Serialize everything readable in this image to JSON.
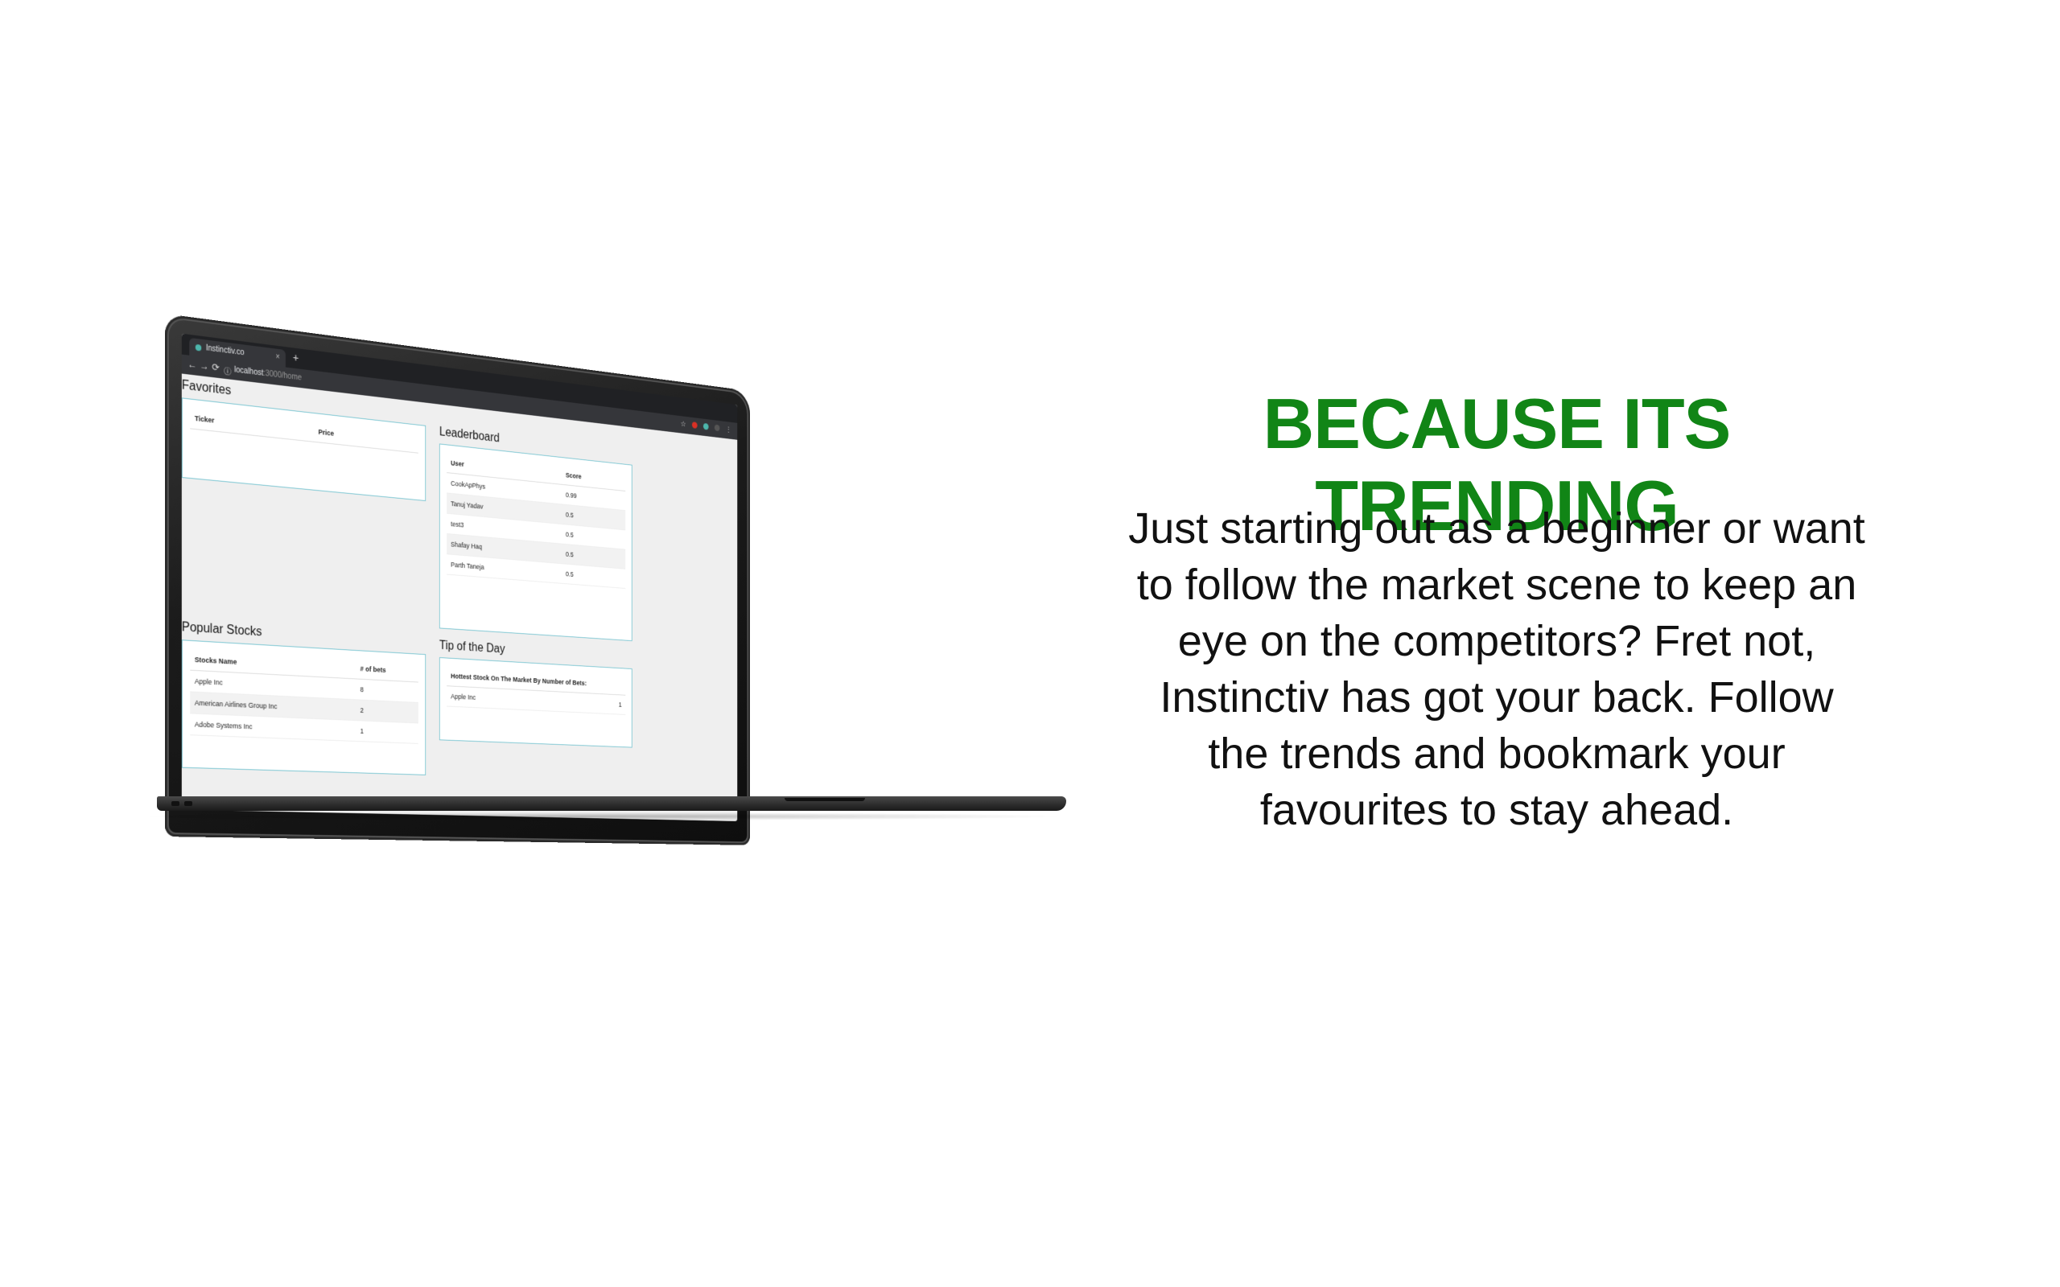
{
  "headline": "BECAUSE ITS TRENDING",
  "body_text": "Just starting out as a beginner or want to follow the market scene to keep an eye on the competitors? Fret not, Instinctiv has got your back. Follow the trends and bookmark your favourites to stay ahead.",
  "colors": {
    "headline": "#118516",
    "card_border": "#7cc6d2",
    "background": "#ffffff"
  },
  "browser": {
    "tab_title": "Instinctiv.co",
    "tab_close": "×",
    "new_tab": "+",
    "url_host": "localhost",
    "url_path": ":3000/home",
    "back": "←",
    "forward": "→",
    "reload": "⟳",
    "info": "ⓘ",
    "star": "☆",
    "menu": "⋮"
  },
  "app": {
    "favorites": {
      "title": "Favorites",
      "columns": [
        "Ticker",
        "Price"
      ]
    },
    "popular": {
      "title": "Popular Stocks",
      "columns": [
        "Stocks Name",
        "# of bets"
      ],
      "rows": [
        {
          "name": "Apple Inc",
          "bets": "8"
        },
        {
          "name": "American Airlines Group Inc",
          "bets": "2"
        },
        {
          "name": "Adobe Systems Inc",
          "bets": "1"
        }
      ]
    },
    "leaderboard": {
      "title": "Leaderboard",
      "columns": [
        "User",
        "Score"
      ],
      "rows": [
        {
          "user": "CookApPhys",
          "score": "0.99"
        },
        {
          "user": "Tanuj Yadav",
          "score": "0.5"
        },
        {
          "user": "test3",
          "score": "0.5"
        },
        {
          "user": "Shafay Haq",
          "score": "0.5"
        },
        {
          "user": "Parth Taneja",
          "score": "0.5"
        }
      ]
    },
    "tip": {
      "title": "Tip of the Day",
      "header": "Hottest Stock On The Market By Number of Bets:",
      "row": {
        "name": "Apple Inc",
        "value": "1"
      }
    }
  }
}
